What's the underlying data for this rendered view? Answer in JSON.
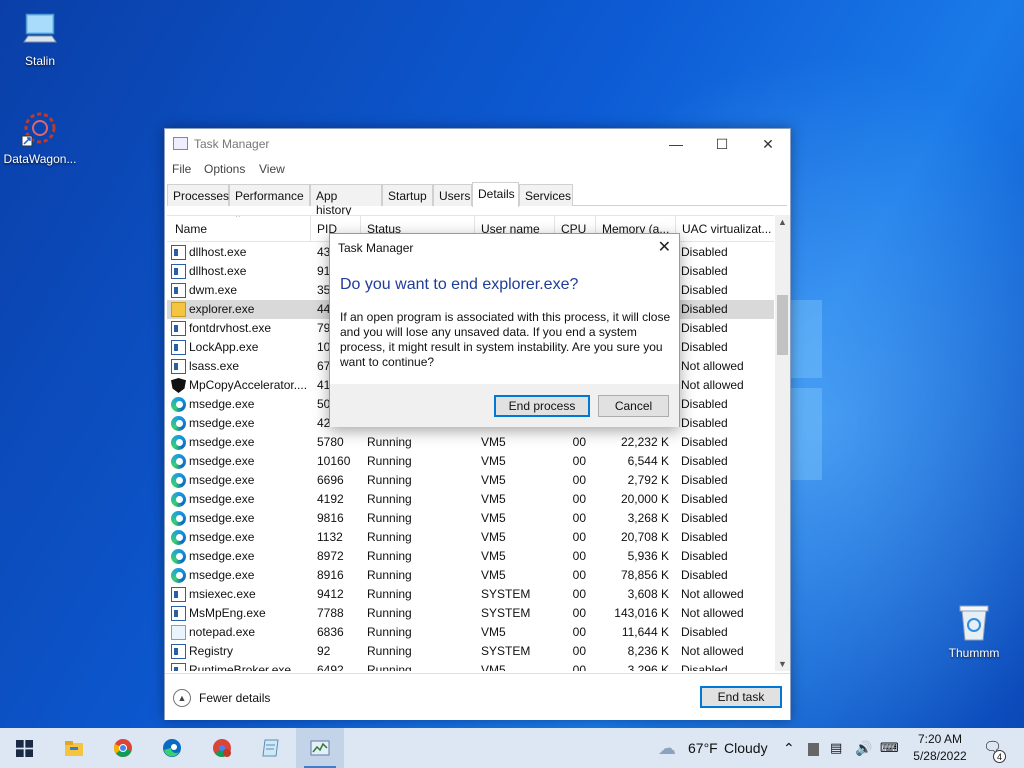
{
  "desktop": {
    "icons": [
      {
        "label": "Stalin"
      },
      {
        "label": "DataWagon..."
      },
      {
        "label": "Thummm"
      }
    ]
  },
  "task_manager": {
    "title": "Task Manager",
    "menu": [
      "File",
      "Options",
      "View"
    ],
    "tabs": [
      "Processes",
      "Performance",
      "App history",
      "Startup",
      "Users",
      "Details",
      "Services"
    ],
    "active_tab": "Details",
    "columns": [
      "Name",
      "PID",
      "Status",
      "User name",
      "CPU",
      "Memory (a...",
      "UAC virtualizat..."
    ],
    "rows": [
      {
        "icon": "exe-icon",
        "name": "dllhost.exe",
        "pid": "43",
        "status": "",
        "user": "",
        "cpu": "",
        "mem": "",
        "uac": "Disabled"
      },
      {
        "icon": "exe-icon",
        "name": "dllhost.exe",
        "pid": "91",
        "status": "",
        "user": "",
        "cpu": "",
        "mem": "",
        "uac": "Disabled"
      },
      {
        "icon": "exe-icon",
        "name": "dwm.exe",
        "pid": "35",
        "status": "",
        "user": "",
        "cpu": "",
        "mem": "",
        "uac": "Disabled"
      },
      {
        "icon": "folder-icon",
        "name": "explorer.exe",
        "pid": "44",
        "status": "",
        "user": "",
        "cpu": "",
        "mem": "",
        "uac": "Disabled",
        "selected": true
      },
      {
        "icon": "exe-icon",
        "name": "fontdrvhost.exe",
        "pid": "79",
        "status": "",
        "user": "",
        "cpu": "",
        "mem": "",
        "uac": "Disabled"
      },
      {
        "icon": "exe-icon",
        "name": "LockApp.exe",
        "pid": "10",
        "status": "",
        "user": "",
        "cpu": "",
        "mem": "",
        "uac": "Disabled"
      },
      {
        "icon": "exe-icon",
        "name": "lsass.exe",
        "pid": "67",
        "status": "",
        "user": "",
        "cpu": "",
        "mem": "",
        "uac": "Not allowed"
      },
      {
        "icon": "shield-icon",
        "name": "MpCopyAccelerator....",
        "pid": "41",
        "status": "",
        "user": "",
        "cpu": "",
        "mem": "",
        "uac": "Not allowed"
      },
      {
        "icon": "edge-icon",
        "name": "msedge.exe",
        "pid": "50",
        "status": "",
        "user": "",
        "cpu": "",
        "mem": "",
        "uac": "Disabled"
      },
      {
        "icon": "edge-icon",
        "name": "msedge.exe",
        "pid": "42",
        "status": "",
        "user": "",
        "cpu": "",
        "mem": "",
        "uac": "Disabled"
      },
      {
        "icon": "edge-icon",
        "name": "msedge.exe",
        "pid": "5780",
        "status": "Running",
        "user": "VM5",
        "cpu": "00",
        "mem": "22,232 K",
        "uac": "Disabled"
      },
      {
        "icon": "edge-icon",
        "name": "msedge.exe",
        "pid": "10160",
        "status": "Running",
        "user": "VM5",
        "cpu": "00",
        "mem": "6,544 K",
        "uac": "Disabled"
      },
      {
        "icon": "edge-icon",
        "name": "msedge.exe",
        "pid": "6696",
        "status": "Running",
        "user": "VM5",
        "cpu": "00",
        "mem": "2,792 K",
        "uac": "Disabled"
      },
      {
        "icon": "edge-icon",
        "name": "msedge.exe",
        "pid": "4192",
        "status": "Running",
        "user": "VM5",
        "cpu": "00",
        "mem": "20,000 K",
        "uac": "Disabled"
      },
      {
        "icon": "edge-icon",
        "name": "msedge.exe",
        "pid": "9816",
        "status": "Running",
        "user": "VM5",
        "cpu": "00",
        "mem": "3,268 K",
        "uac": "Disabled"
      },
      {
        "icon": "edge-icon",
        "name": "msedge.exe",
        "pid": "1132",
        "status": "Running",
        "user": "VM5",
        "cpu": "00",
        "mem": "20,708 K",
        "uac": "Disabled"
      },
      {
        "icon": "edge-icon",
        "name": "msedge.exe",
        "pid": "8972",
        "status": "Running",
        "user": "VM5",
        "cpu": "00",
        "mem": "5,936 K",
        "uac": "Disabled"
      },
      {
        "icon": "edge-icon",
        "name": "msedge.exe",
        "pid": "8916",
        "status": "Running",
        "user": "VM5",
        "cpu": "00",
        "mem": "78,856 K",
        "uac": "Disabled"
      },
      {
        "icon": "exe-icon",
        "name": "msiexec.exe",
        "pid": "9412",
        "status": "Running",
        "user": "SYSTEM",
        "cpu": "00",
        "mem": "3,608 K",
        "uac": "Not allowed"
      },
      {
        "icon": "exe-icon",
        "name": "MsMpEng.exe",
        "pid": "7788",
        "status": "Running",
        "user": "SYSTEM",
        "cpu": "00",
        "mem": "143,016 K",
        "uac": "Not allowed"
      },
      {
        "icon": "note-icon",
        "name": "notepad.exe",
        "pid": "6836",
        "status": "Running",
        "user": "VM5",
        "cpu": "00",
        "mem": "11,644 K",
        "uac": "Disabled"
      },
      {
        "icon": "exe-icon",
        "name": "Registry",
        "pid": "92",
        "status": "Running",
        "user": "SYSTEM",
        "cpu": "00",
        "mem": "8,236 K",
        "uac": "Not allowed"
      },
      {
        "icon": "exe-icon",
        "name": "RuntimeBroker.exe",
        "pid": "6492",
        "status": "Running",
        "user": "VM5",
        "cpu": "00",
        "mem": "3,296 K",
        "uac": "Disabled"
      }
    ],
    "fewer_details": "Fewer details",
    "end_task": "End task"
  },
  "dialog": {
    "title": "Task Manager",
    "heading": "Do you want to end explorer.exe?",
    "body": "If an open program is associated with this process, it will close and you will lose any unsaved data. If you end a system process, it might result in system instability. Are you sure you want to continue?",
    "end_process": "End process",
    "cancel": "Cancel"
  },
  "taskbar": {
    "weather_temp": "67°F",
    "weather_text": "Cloudy",
    "time": "7:20 AM",
    "date": "5/28/2022",
    "notification_count": "4"
  },
  "colors": {
    "accent": "#0078d7",
    "dialog_heading": "#1f3d99"
  }
}
